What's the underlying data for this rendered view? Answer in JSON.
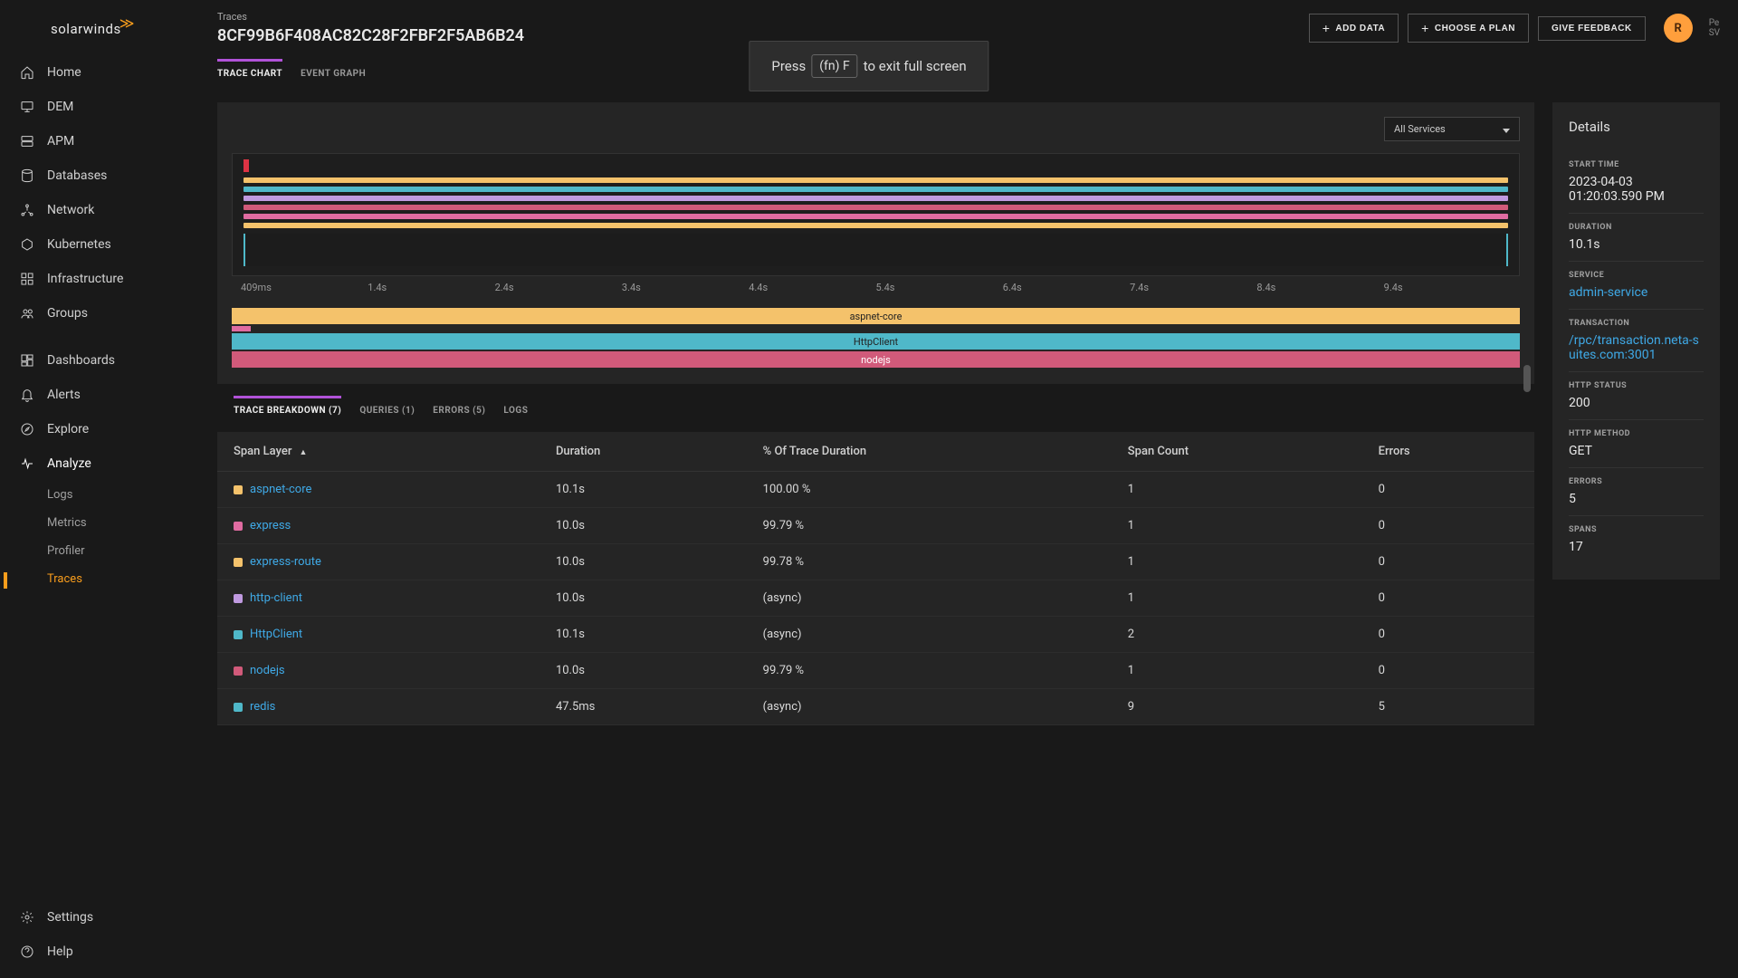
{
  "brand": "solarwinds",
  "nav": {
    "items": [
      {
        "id": "home",
        "label": "Home"
      },
      {
        "id": "dem",
        "label": "DEM"
      },
      {
        "id": "apm",
        "label": "APM"
      },
      {
        "id": "databases",
        "label": "Databases"
      },
      {
        "id": "network",
        "label": "Network"
      },
      {
        "id": "kubernetes",
        "label": "Kubernetes"
      },
      {
        "id": "infrastructure",
        "label": "Infrastructure"
      },
      {
        "id": "groups",
        "label": "Groups"
      },
      {
        "id": "dashboards",
        "label": "Dashboards"
      },
      {
        "id": "alerts",
        "label": "Alerts"
      },
      {
        "id": "explore",
        "label": "Explore"
      },
      {
        "id": "analyze",
        "label": "Analyze"
      },
      {
        "id": "settings",
        "label": "Settings"
      },
      {
        "id": "help",
        "label": "Help"
      }
    ],
    "subnav": {
      "logs": "Logs",
      "metrics": "Metrics",
      "profiler": "Profiler",
      "traces": "Traces"
    }
  },
  "header": {
    "breadcrumb": "Traces",
    "trace_id": "8CF99B6F408AC82C28F2FBF2F5AB6B24",
    "add_data": "Add Data",
    "choose_plan": "Choose A Plan",
    "give_feedback": "Give Feedback",
    "avatar_initial": "R",
    "avatar_name": "Pe",
    "avatar_sub": "SV"
  },
  "fullscreen": {
    "press": "Press",
    "key": "(fn) F",
    "rest": "to exit full screen"
  },
  "view_tabs": {
    "trace_chart": "Trace Chart",
    "event_graph": "Event Graph"
  },
  "chart": {
    "services_filter": "All Services",
    "ticks": [
      "409ms",
      "1.4s",
      "2.4s",
      "3.4s",
      "4.4s",
      "5.4s",
      "6.4s",
      "7.4s",
      "8.4s",
      "9.4s"
    ],
    "legend": [
      {
        "label": "aspnet-core",
        "color": "#f4c26b"
      },
      {
        "label": "",
        "color": "#e06ba1"
      },
      {
        "label": "HttpClient",
        "color": "#4fb8c9"
      },
      {
        "label": "nodejs",
        "color": "#d15a7a"
      }
    ]
  },
  "breakdown_tabs": {
    "trace_breakdown": "Trace Breakdown (7)",
    "queries": "Queries (1)",
    "errors": "Errors (5)",
    "logs": "Logs"
  },
  "table": {
    "headers": {
      "span_layer": "Span Layer",
      "duration": "Duration",
      "pct": "% Of Trace Duration",
      "span_count": "Span Count",
      "errors": "Errors"
    },
    "rows": [
      {
        "layer": "aspnet-core",
        "color": "#f4c26b",
        "duration": "10.1s",
        "pct": "100.00 %",
        "span_count": "1",
        "errors": "0"
      },
      {
        "layer": "express",
        "color": "#e06ba1",
        "duration": "10.0s",
        "pct": "99.79 %",
        "span_count": "1",
        "errors": "0"
      },
      {
        "layer": "express-route",
        "color": "#f4c26b",
        "duration": "10.0s",
        "pct": "99.78 %",
        "span_count": "1",
        "errors": "0"
      },
      {
        "layer": "http-client",
        "color": "#c09ae0",
        "duration": "10.0s",
        "pct": "(async)",
        "span_count": "1",
        "errors": "0"
      },
      {
        "layer": "HttpClient",
        "color": "#4fb8c9",
        "duration": "10.1s",
        "pct": "(async)",
        "span_count": "2",
        "errors": "0"
      },
      {
        "layer": "nodejs",
        "color": "#d15a7a",
        "duration": "10.0s",
        "pct": "99.79 %",
        "span_count": "1",
        "errors": "0"
      },
      {
        "layer": "redis",
        "color": "#4fb8c9",
        "duration": "47.5ms",
        "pct": "(async)",
        "span_count": "9",
        "errors": "5"
      }
    ]
  },
  "details": {
    "title": "Details",
    "start_time_label": "Start Time",
    "start_time": "2023-04-03 01:20:03.590 PM",
    "duration_label": "Duration",
    "duration": "10.1s",
    "service_label": "Service",
    "service": "admin-service",
    "transaction_label": "Transaction",
    "transaction": "/rpc/transaction.neta-suites.com:3001",
    "http_status_label": "HTTP Status",
    "http_status": "200",
    "http_method_label": "HTTP Method",
    "http_method": "GET",
    "errors_label": "Errors",
    "errors": "5",
    "spans_label": "Spans",
    "spans": "17"
  },
  "chart_data": {
    "type": "table",
    "categories": [
      "aspnet-core",
      "express",
      "express-route",
      "http-client",
      "HttpClient",
      "nodejs",
      "redis"
    ],
    "series": [
      {
        "name": "Duration",
        "values": [
          "10.1s",
          "10.0s",
          "10.0s",
          "10.0s",
          "10.1s",
          "10.0s",
          "47.5ms"
        ]
      },
      {
        "name": "% Of Trace Duration",
        "values": [
          "100.00 %",
          "99.79 %",
          "99.78 %",
          "(async)",
          "(async)",
          "99.79 %",
          "(async)"
        ]
      },
      {
        "name": "Span Count",
        "values": [
          1,
          1,
          1,
          1,
          2,
          1,
          9
        ]
      },
      {
        "name": "Errors",
        "values": [
          0,
          0,
          0,
          0,
          0,
          0,
          5
        ]
      }
    ],
    "title": "Trace Breakdown",
    "timeline_ticks": [
      "409ms",
      "1.4s",
      "2.4s",
      "3.4s",
      "4.4s",
      "5.4s",
      "6.4s",
      "7.4s",
      "8.4s",
      "9.4s"
    ]
  }
}
